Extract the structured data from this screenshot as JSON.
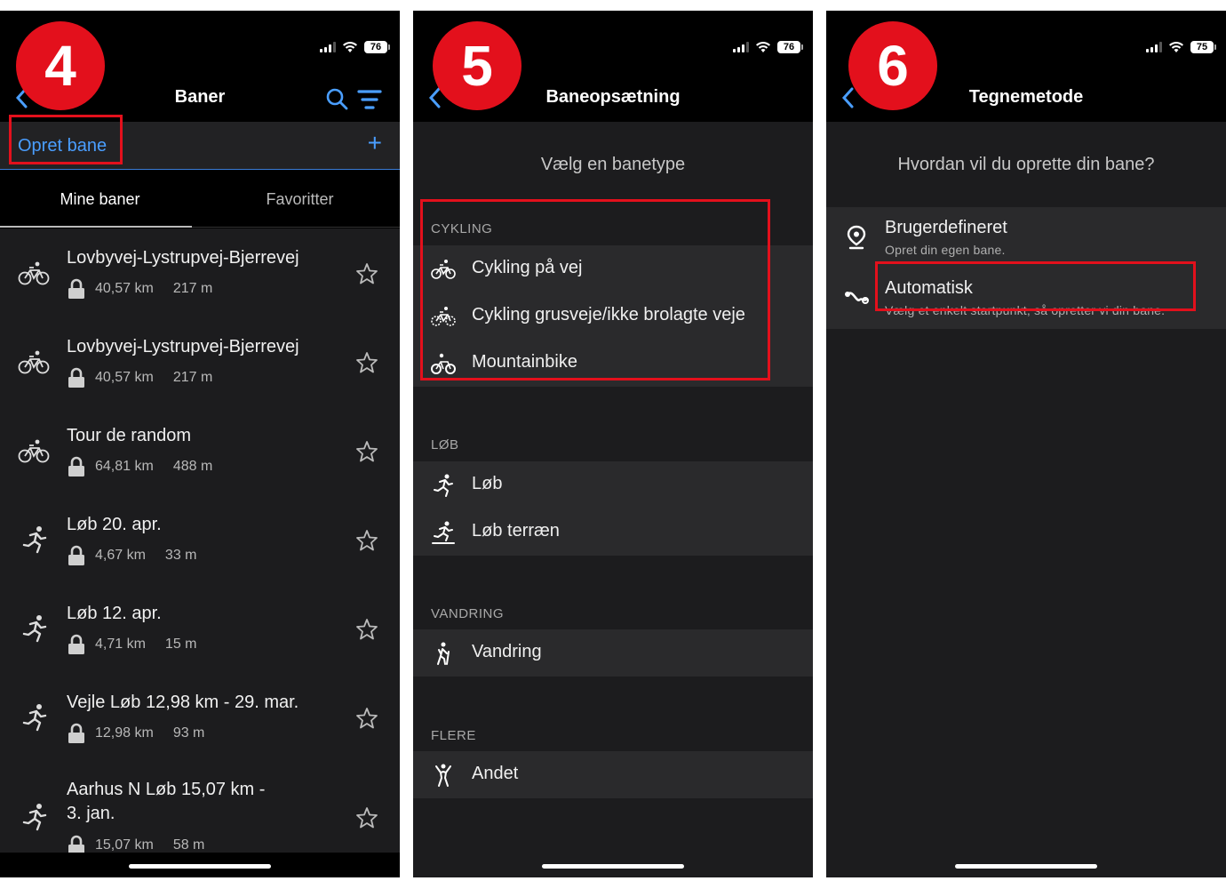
{
  "steps": [
    "4",
    "5",
    "6"
  ],
  "status": [
    {
      "battery": "76"
    },
    {
      "battery": "76"
    },
    {
      "battery": "75"
    }
  ],
  "screen1": {
    "title": "Baner",
    "create_label": "Opret bane",
    "tabs": [
      "Mine baner",
      "Favoritter"
    ],
    "courses": [
      {
        "name": "Lovbyvej-Lystrupvej-Bjerrevej",
        "distance": "40,57 km",
        "elevation": "217 m",
        "icon": "bike-icon"
      },
      {
        "name": "Lovbyvej-Lystrupvej-Bjerrevej",
        "distance": "40,57 km",
        "elevation": "217 m",
        "icon": "bike-icon"
      },
      {
        "name": "Tour de random",
        "distance": "64,81 km",
        "elevation": "488 m",
        "icon": "bike-icon"
      },
      {
        "name": "Løb 20. apr.",
        "distance": "4,67 km",
        "elevation": "33 m",
        "icon": "run-icon"
      },
      {
        "name": "Løb 12. apr.",
        "distance": "4,71 km",
        "elevation": "15 m",
        "icon": "run-icon"
      },
      {
        "name": "Vejle Løb 12,98 km - 29. mar.",
        "distance": "12,98 km",
        "elevation": "93 m",
        "icon": "run-icon"
      },
      {
        "name": "Aarhus N Løb 15,07 km -\n3. jan.",
        "distance": "15,07 km",
        "elevation": "58 m",
        "icon": "run-icon"
      }
    ]
  },
  "screen2": {
    "title": "Baneopsætning",
    "subtitle": "Vælg en banetype",
    "sections": [
      {
        "label": "CYKLING",
        "items": [
          "Cykling på vej",
          "Cykling grusveje/ikke brolagte veje",
          "Mountainbike"
        ]
      },
      {
        "label": "LØB",
        "items": [
          "Løb",
          "Løb terræn"
        ]
      },
      {
        "label": "VANDRING",
        "items": [
          "Vandring"
        ]
      },
      {
        "label": "FLERE",
        "items": [
          "Andet"
        ]
      }
    ]
  },
  "screen3": {
    "title": "Tegnemetode",
    "subtitle": "Hvordan vil du oprette din bane?",
    "options": [
      {
        "title": "Brugerdefineret",
        "desc": "Opret din egen bane."
      },
      {
        "title": "Automatisk",
        "desc": "Vælg et enkelt startpunkt, så opretter vi din bane."
      }
    ]
  },
  "colors": {
    "accent": "#4a9eff",
    "highlight": "#e3101c",
    "background": "#1c1c1e",
    "row": "#2a2a2c"
  }
}
